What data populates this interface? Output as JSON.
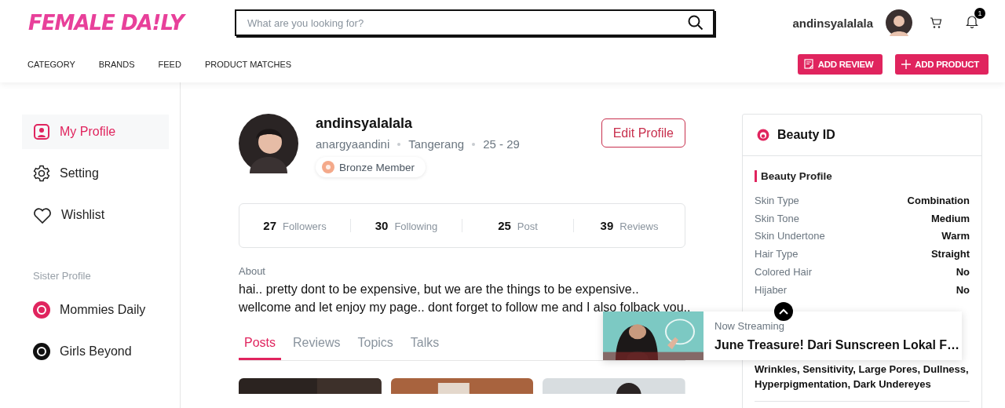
{
  "header": {
    "logo": "FEMALE DA!LY",
    "search": {
      "placeholder": "What are you looking for?"
    },
    "username": "andinsyalalala",
    "notification_count": "1",
    "nav": [
      "CATEGORY",
      "BRANDS",
      "FEED",
      "PRODUCT MATCHES"
    ],
    "buttons": [
      {
        "kind": "review",
        "label": "ADD REVIEW"
      },
      {
        "kind": "product",
        "label": "ADD PRODUCT"
      }
    ]
  },
  "sidebar": {
    "items": [
      {
        "label": "My Profile",
        "selected": true
      },
      {
        "label": "Setting",
        "selected": false
      },
      {
        "label": "Wishlist",
        "selected": false
      }
    ],
    "sister_heading": "Sister Profile",
    "sister_items": [
      {
        "label": "Mommies Daily",
        "color": "#e0245e"
      },
      {
        "label": "Girls Beyond",
        "color": "#111111"
      }
    ]
  },
  "profile": {
    "name": "andinsyalalala",
    "handle": "anargyaandini",
    "city": "Tangerang",
    "age": "25 - 29",
    "badge": "Bronze Member",
    "edit": "Edit Profile",
    "stats": [
      {
        "count": "27",
        "label": "Followers"
      },
      {
        "count": "30",
        "label": "Following"
      },
      {
        "count": "25",
        "label": "Post"
      },
      {
        "count": "39",
        "label": "Reviews"
      }
    ],
    "about_heading": "About",
    "about": "hai.. pretty dont to be expensive, but we are the things to be expensive.. wellcome and let enjoy my page.. dont forget to follow me and I also folback you..",
    "tabs": [
      {
        "label": "Posts",
        "selected": true
      },
      {
        "label": "Reviews",
        "selected": false
      },
      {
        "label": "Topics",
        "selected": false
      },
      {
        "label": "Talks",
        "selected": false
      }
    ]
  },
  "beauty_id": {
    "title": "Beauty ID",
    "section": "Beauty Profile",
    "rows": [
      {
        "label": "Skin Type",
        "value": "Combination"
      },
      {
        "label": "Skin Tone",
        "value": "Medium"
      },
      {
        "label": "Skin Undertone",
        "value": "Warm"
      },
      {
        "label": "Hair Type",
        "value": "Straight"
      },
      {
        "label": "Colored Hair",
        "value": "No"
      },
      {
        "label": "Hijaber",
        "value": "No"
      }
    ],
    "concerns": "Wrinkles, Sensitivity, Large Pores, Dullness, Hyperpigmentation, Dark Undereyes"
  },
  "streaming": {
    "label": "Now Streaming",
    "title": "June Treasure! Dari Sunscreen Lokal F…"
  }
}
